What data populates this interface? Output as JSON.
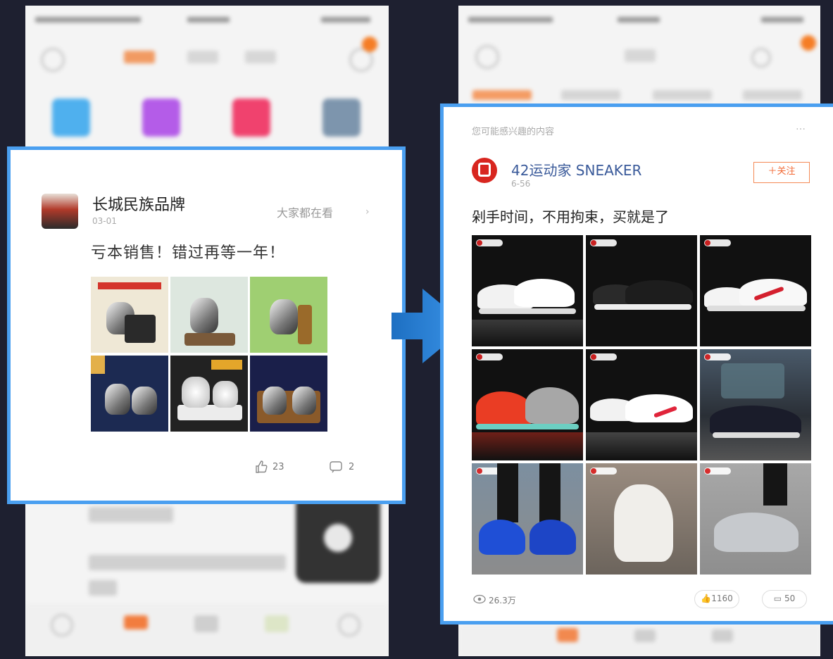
{
  "left_card": {
    "author": "长城民族品牌",
    "date": "03-01",
    "aside": "大家都在看",
    "text": "亏本销售！错过再等一年！",
    "likes": "23",
    "comments": "2"
  },
  "right_card": {
    "header": "您可能感兴趣的内容",
    "author": "42运动家 SNEAKER",
    "date": "6-56",
    "follow_label": "关注",
    "text": "剁手时间，不用拘束，买就是了",
    "views": "26.3万",
    "likes": "1160",
    "comments": "50"
  },
  "colors": {
    "highlight": "#4a9ff0",
    "arrow": "#2f86d8",
    "accent": "#f26a36"
  },
  "icons": {
    "like": "thumb-up-icon",
    "comment": "comment-icon",
    "views": "eye-icon",
    "arrow": "arrow-right-icon"
  }
}
